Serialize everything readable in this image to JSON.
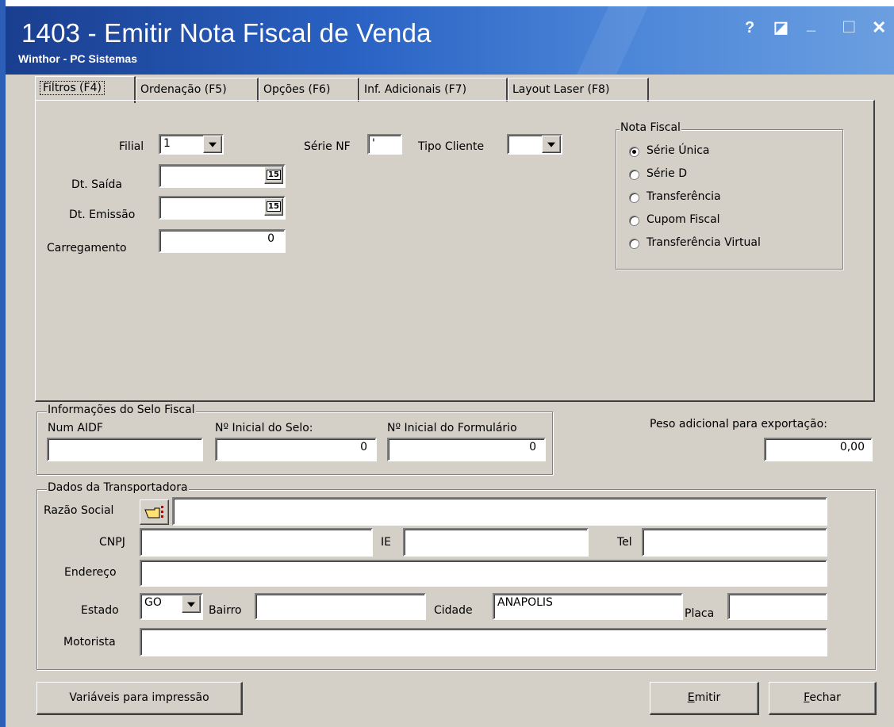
{
  "window": {
    "title": "1403 - Emitir Nota Fiscal de Venda",
    "subtitle": "Winthor - PC Sistemas",
    "controls": {
      "help": "?",
      "restore": "◪",
      "minimize": "_",
      "maximize": "□",
      "close": "✕"
    }
  },
  "tabs": [
    {
      "label": "Filtros (F4)"
    },
    {
      "label": "Ordenação (F5)"
    },
    {
      "label": "Opções (F6)"
    },
    {
      "label": "Inf. Adicionais (F7)"
    },
    {
      "label": "Layout Laser (F8)"
    }
  ],
  "filtros": {
    "filial_label": "Filial",
    "filial_value": "1",
    "serie_nf_label": "Série NF",
    "serie_nf_value": "'",
    "tipo_cliente_label": "Tipo Cliente",
    "tipo_cliente_value": "",
    "dt_saida_label": "Dt. Saída",
    "dt_saida_value": "",
    "dt_emissao_label": "Dt. Emissão",
    "dt_emissao_value": "",
    "carregamento_label": "Carregamento",
    "carregamento_value": "0",
    "calendar_glyph": "15"
  },
  "nota_fiscal": {
    "title": "Nota Fiscal",
    "options": [
      {
        "label": "Série Única",
        "selected": true
      },
      {
        "label": "Série D",
        "selected": false
      },
      {
        "label": "Transferência",
        "selected": false
      },
      {
        "label": "Cupom Fiscal",
        "selected": false
      },
      {
        "label": "Transferência Virtual",
        "selected": false
      }
    ]
  },
  "selo_fiscal": {
    "title": "Informações do Selo Fiscal",
    "num_aidf_label": "Num AIDF",
    "num_aidf_value": "",
    "inicial_selo_label": "Nº Inicial do Selo:",
    "inicial_selo_value": "0",
    "inicial_form_label": "Nº Inicial do Formulário",
    "inicial_form_value": "0"
  },
  "peso": {
    "label": "Peso adicional para exportação:",
    "value": "0,00"
  },
  "transportadora": {
    "title": "Dados da Transportadora",
    "razao_social_label": "Razão Social",
    "razao_social_value": "",
    "cnpj_label": "CNPJ",
    "cnpj_value": "",
    "ie_label": "IE",
    "ie_value": "",
    "tel_label": "Tel",
    "tel_value": "",
    "endereco_label": "Endereço",
    "endereco_value": "",
    "estado_label": "Estado",
    "estado_value": "GO",
    "bairro_label": "Bairro",
    "bairro_value": "",
    "cidade_label": "Cidade",
    "cidade_value": "ANAPOLIS",
    "placa_label": "Placa",
    "placa_value": "",
    "motorista_label": "Motorista",
    "motorista_value": ""
  },
  "buttons": {
    "variaveis": "Variáveis para impressão",
    "emitir_first": "E",
    "emitir_rest": "mitir",
    "fechar_first": "F",
    "fechar_rest": "echar"
  },
  "colors": {
    "titlebar_start": "#1a3e8f",
    "titlebar_end": "#6b9fe0",
    "face": "#d4d0c8"
  }
}
